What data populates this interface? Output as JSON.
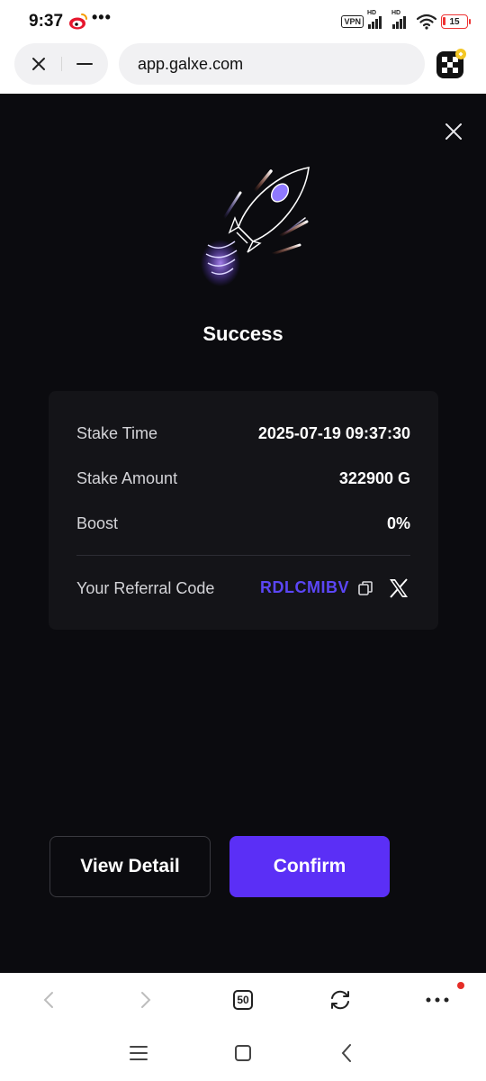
{
  "status_bar": {
    "time": "9:37",
    "dots": "•••",
    "vpn": "VPN",
    "hd1": "HD",
    "hd2": "HD",
    "battery": "15"
  },
  "browser": {
    "url": "app.galxe.com"
  },
  "modal": {
    "title": "Success",
    "rows": [
      {
        "label": "Stake Time",
        "value": "2025-07-19 09:37:30"
      },
      {
        "label": "Stake Amount",
        "value": "322900 G"
      },
      {
        "label": "Boost",
        "value": "0%"
      }
    ],
    "referral": {
      "label": "Your Referral Code",
      "code": "RDLCMIBV"
    },
    "buttons": {
      "view_detail": "View Detail",
      "confirm": "Confirm"
    }
  },
  "browser_nav": {
    "tab_count": "50"
  },
  "colors": {
    "accent": "#5b2ff6",
    "referral_code": "#5b46f5",
    "background": "#0b0b0f",
    "card": "#141418"
  }
}
